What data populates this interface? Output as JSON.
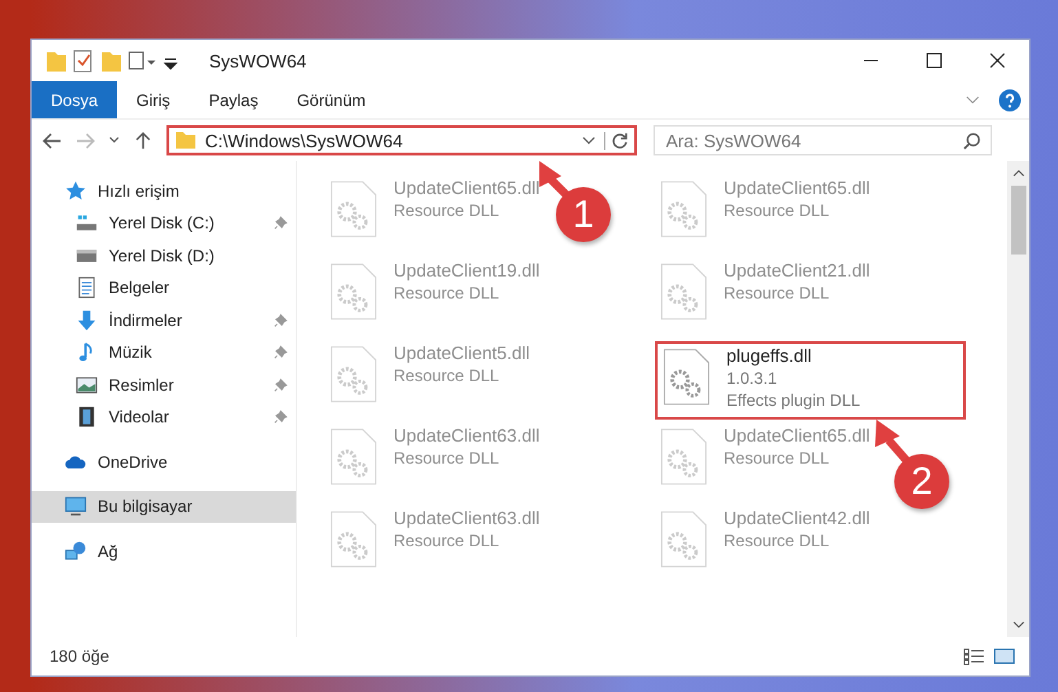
{
  "window": {
    "title": "SysWOW64"
  },
  "ribbon_tabs": [
    {
      "label": "Dosya",
      "selected": true
    },
    {
      "label": "Giriş",
      "selected": false
    },
    {
      "label": "Paylaş",
      "selected": false
    },
    {
      "label": "Görünüm",
      "selected": false
    }
  ],
  "address_bar": {
    "path": "C:\\Windows\\SysWOW64",
    "highlighted": true
  },
  "search": {
    "placeholder": "Ara: SysWOW64"
  },
  "sidebar": {
    "groups": [
      {
        "items": [
          {
            "label": "Hızlı erişim",
            "kind": "star",
            "pinned": false,
            "selected": false,
            "child": false
          },
          {
            "label": "Yerel Disk (C:)",
            "kind": "sysdrive",
            "pinned": true,
            "selected": false,
            "child": true
          },
          {
            "label": "Yerel Disk (D:)",
            "kind": "drive",
            "pinned": false,
            "selected": false,
            "child": true
          },
          {
            "label": "Belgeler",
            "kind": "docs",
            "pinned": false,
            "selected": false,
            "child": true
          },
          {
            "label": "İndirmeler",
            "kind": "download",
            "pinned": true,
            "selected": false,
            "child": true
          },
          {
            "label": "Müzik",
            "kind": "music",
            "pinned": true,
            "selected": false,
            "child": true
          },
          {
            "label": "Resimler",
            "kind": "pictures",
            "pinned": true,
            "selected": false,
            "child": true
          },
          {
            "label": "Videolar",
            "kind": "video",
            "pinned": true,
            "selected": false,
            "child": true
          }
        ]
      },
      {
        "items": [
          {
            "label": "OneDrive",
            "kind": "cloud",
            "pinned": false,
            "selected": false,
            "child": false
          }
        ]
      },
      {
        "items": [
          {
            "label": "Bu bilgisayar",
            "kind": "computer",
            "pinned": false,
            "selected": true,
            "child": false
          }
        ]
      },
      {
        "items": [
          {
            "label": "Ağ",
            "kind": "network",
            "pinned": false,
            "selected": false,
            "child": false
          }
        ]
      }
    ]
  },
  "files": [
    {
      "name": "UpdateClient65.dll",
      "lines": [
        "Resource DLL"
      ],
      "blurred": true,
      "highlighted": false
    },
    {
      "name": "UpdateClient65.dll",
      "lines": [
        "Resource DLL"
      ],
      "blurred": true,
      "highlighted": false
    },
    {
      "name": "UpdateClient19.dll",
      "lines": [
        "Resource DLL"
      ],
      "blurred": true,
      "highlighted": false
    },
    {
      "name": "UpdateClient21.dll",
      "lines": [
        "Resource DLL"
      ],
      "blurred": true,
      "highlighted": false
    },
    {
      "name": "UpdateClient5.dll",
      "lines": [
        "Resource DLL"
      ],
      "blurred": true,
      "highlighted": false
    },
    {
      "name": "plugeffs.dll",
      "lines": [
        "1.0.3.1",
        "Effects plugin DLL"
      ],
      "blurred": false,
      "highlighted": true
    },
    {
      "name": "UpdateClient63.dll",
      "lines": [
        "Resource DLL"
      ],
      "blurred": true,
      "highlighted": false
    },
    {
      "name": "UpdateClient65.dll",
      "lines": [
        "Resource DLL"
      ],
      "blurred": true,
      "highlighted": false
    },
    {
      "name": "UpdateClient63.dll",
      "lines": [
        "Resource DLL"
      ],
      "blurred": true,
      "highlighted": false
    },
    {
      "name": "UpdateClient42.dll",
      "lines": [
        "Resource DLL"
      ],
      "blurred": true,
      "highlighted": false
    }
  ],
  "status_bar": {
    "count": "180 öğe"
  },
  "callouts": [
    {
      "number": "1"
    },
    {
      "number": "2"
    }
  ]
}
